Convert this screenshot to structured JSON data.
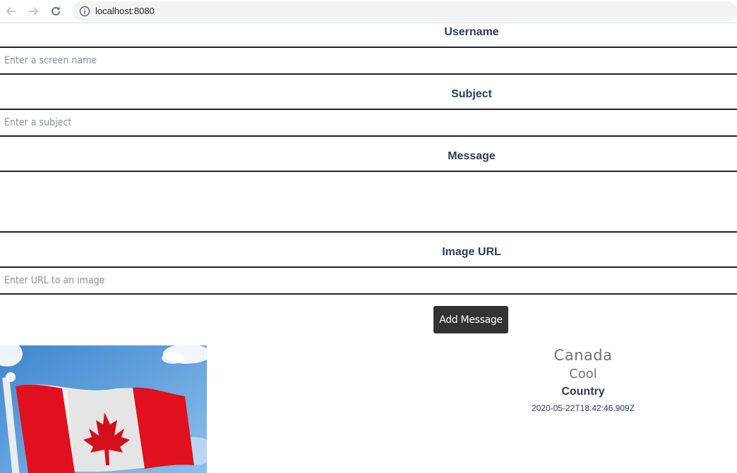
{
  "browser": {
    "url": "localhost:8080"
  },
  "form": {
    "username_label": "Username",
    "username_placeholder": "Enter a screen name",
    "subject_label": "Subject",
    "subject_placeholder": "Enter a subject",
    "message_label": "Message",
    "image_url_label": "Image URL",
    "image_url_placeholder": "Enter URL to an image",
    "submit_label": "Add Message"
  },
  "messages": [
    {
      "username": "Canada",
      "subject": "Cool",
      "message": "Country",
      "created": "2020-05-22T18:42:46.909Z",
      "image": "canada-flag"
    }
  ],
  "colors": {
    "heading": "#2c3e50",
    "button": "#333333",
    "flag_red": "#e8112d",
    "sky": "#4a90d9"
  }
}
